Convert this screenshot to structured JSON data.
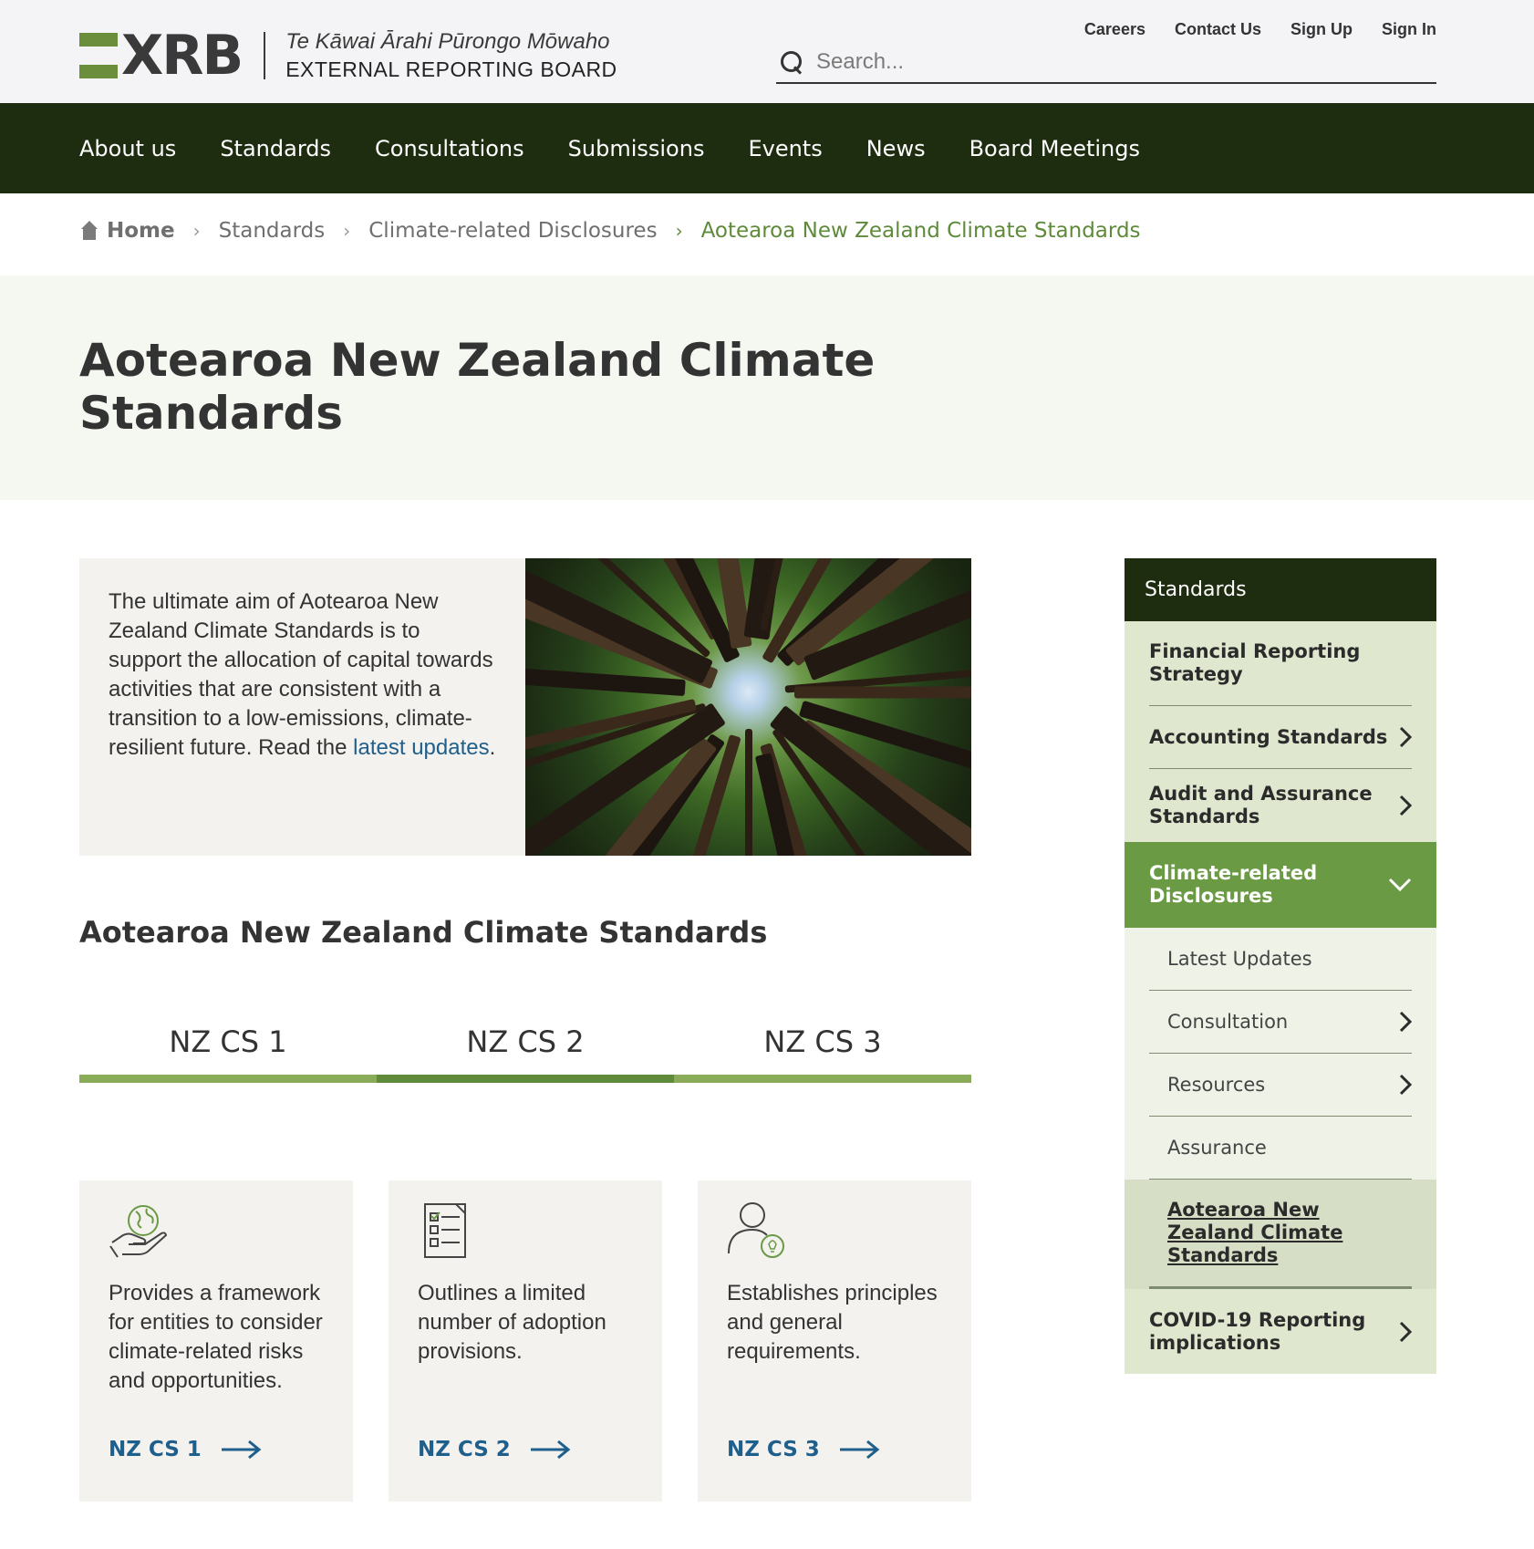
{
  "header": {
    "logo_text": "XRB",
    "logo_maori": "Te Kāwai Ārahi Pūrongo Mōwaho",
    "logo_english": "EXTERNAL REPORTING BOARD",
    "utility_links": [
      "Careers",
      "Contact Us",
      "Sign Up",
      "Sign In"
    ],
    "search_placeholder": "Search..."
  },
  "main_nav": [
    "About us",
    "Standards",
    "Consultations",
    "Submissions",
    "Events",
    "News",
    "Board Meetings"
  ],
  "breadcrumb": {
    "home": "Home",
    "items": [
      "Standards",
      "Climate-related Disclosures"
    ],
    "current": "Aotearoa New Zealand Climate Standards"
  },
  "page_title": "Aotearoa New Zealand Climate Standards",
  "intro": {
    "text": "The ultimate aim of Aotearoa New Zealand Climate Standards is to support the allocation of capital towards activities that are consistent with a transition to a low-emissions, climate-resilient future. Read the ",
    "link_text": "latest updates",
    "suffix": "."
  },
  "section_title": "Aotearoa New Zealand Climate Standards",
  "tabs": [
    {
      "label": "NZ CS 1",
      "active": false
    },
    {
      "label": "NZ CS 2",
      "active": true
    },
    {
      "label": "NZ CS 3",
      "active": false
    }
  ],
  "cards": [
    {
      "icon": "hand-globe-icon",
      "text": "Provides a framework for entities to consider climate-related risks and opportunities.",
      "link": "NZ CS 1"
    },
    {
      "icon": "checklist-icon",
      "text": "Outlines a limited number of adoption provisions.",
      "link": "NZ CS 2"
    },
    {
      "icon": "person-idea-icon",
      "text": "Establishes principles and general requirements.",
      "link": "NZ CS 3"
    }
  ],
  "sidebar": {
    "title": "Standards",
    "items": [
      {
        "label": "Financial Reporting Strategy",
        "chevron": false
      },
      {
        "label": "Accounting Standards",
        "chevron": true
      },
      {
        "label": "Audit and Assurance Standards",
        "chevron": true
      },
      {
        "label": "Climate-related Disclosures",
        "open": true
      }
    ],
    "sub_items": [
      {
        "label": "Latest Updates",
        "chevron": false
      },
      {
        "label": "Consultation",
        "chevron": true
      },
      {
        "label": "Resources",
        "chevron": true
      },
      {
        "label": "Assurance",
        "chevron": false
      },
      {
        "label": "Aotearoa New Zealand Climate Standards",
        "current": true
      }
    ],
    "last_item": {
      "label": "COVID-19 Reporting implications",
      "chevron": true
    }
  },
  "colors": {
    "nav_bg": "#1e2d10",
    "accent_green": "#5e8a3a",
    "link_blue": "#1f5f8b",
    "tab_bar": "#8aab58"
  }
}
